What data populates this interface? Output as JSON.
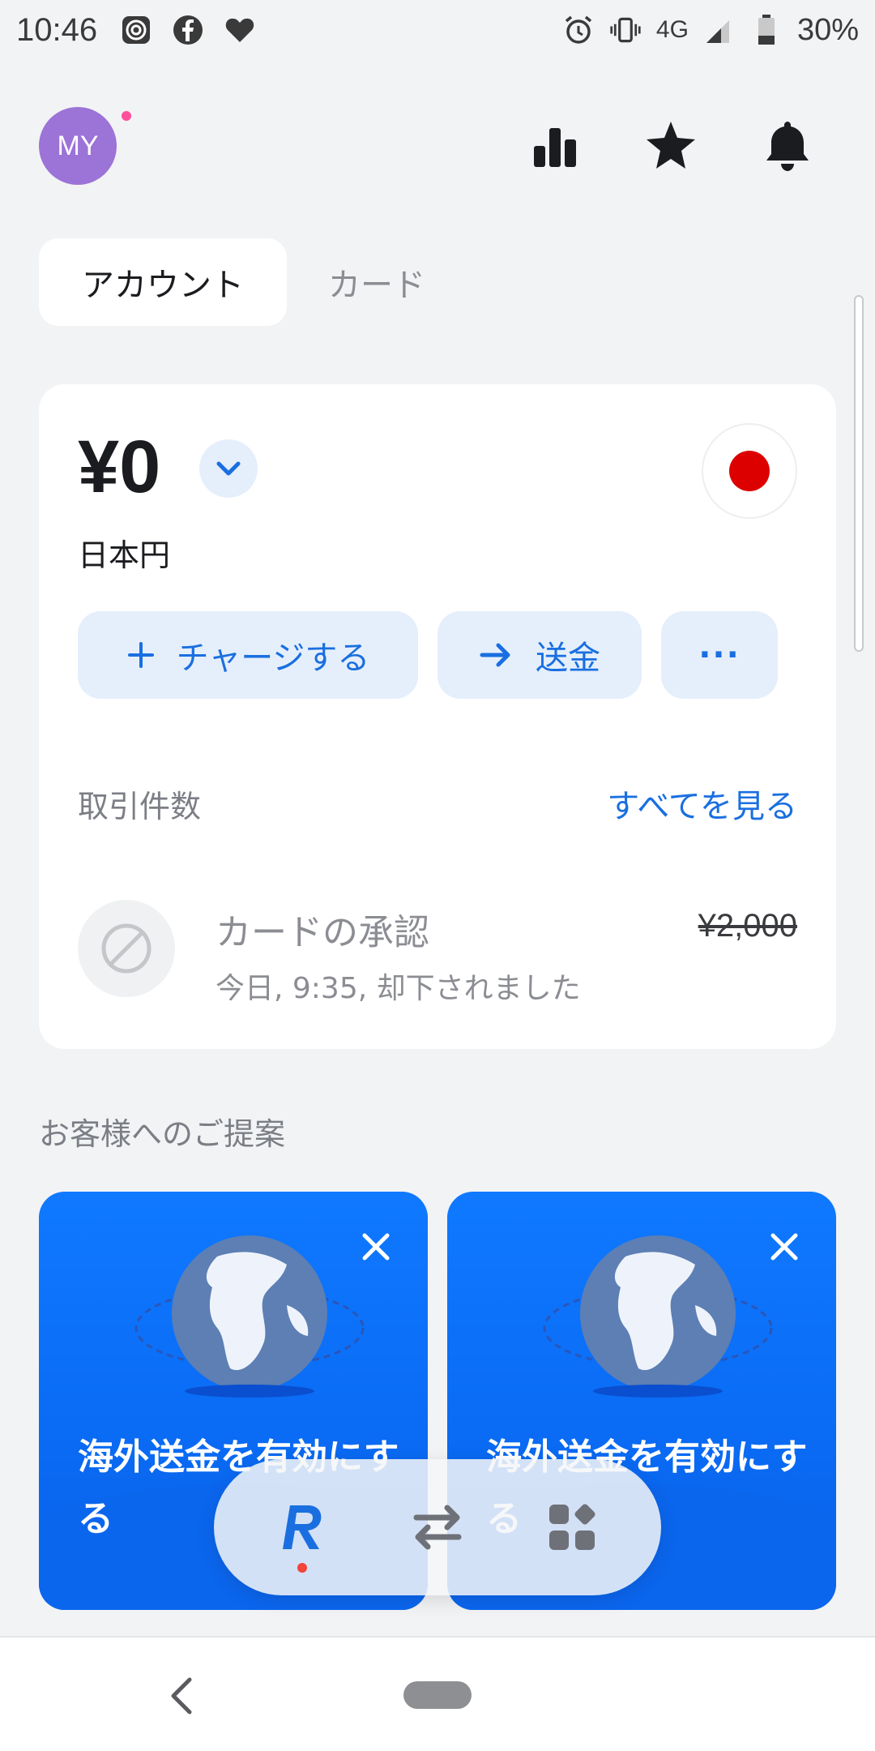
{
  "status_bar": {
    "time": "10:46",
    "network": "4G",
    "battery": "30%"
  },
  "header": {
    "avatar_initials": "MY"
  },
  "tabs": [
    {
      "label": "アカウント"
    },
    {
      "label": "カード"
    }
  ],
  "account": {
    "balance": "¥0",
    "currency_name": "日本円",
    "actions": {
      "topup": "チャージする",
      "send": "送金",
      "more": "···"
    }
  },
  "transactions": {
    "title": "取引件数",
    "see_all": "すべてを見る",
    "items": [
      {
        "name": "カードの承認",
        "subtitle": "今日, 9:35, 却下されました",
        "amount": "¥2,000"
      }
    ]
  },
  "suggestions": {
    "title": "お客様へのご提案",
    "cards": [
      {
        "text": "海外送金を有効にする"
      },
      {
        "text": "海外送金を有効にする"
      }
    ]
  },
  "colors": {
    "accent": "#1a6fe0",
    "promo_bg": "#0f79ff",
    "avatar": "#9c73d6",
    "flag_red": "#dd0000"
  }
}
